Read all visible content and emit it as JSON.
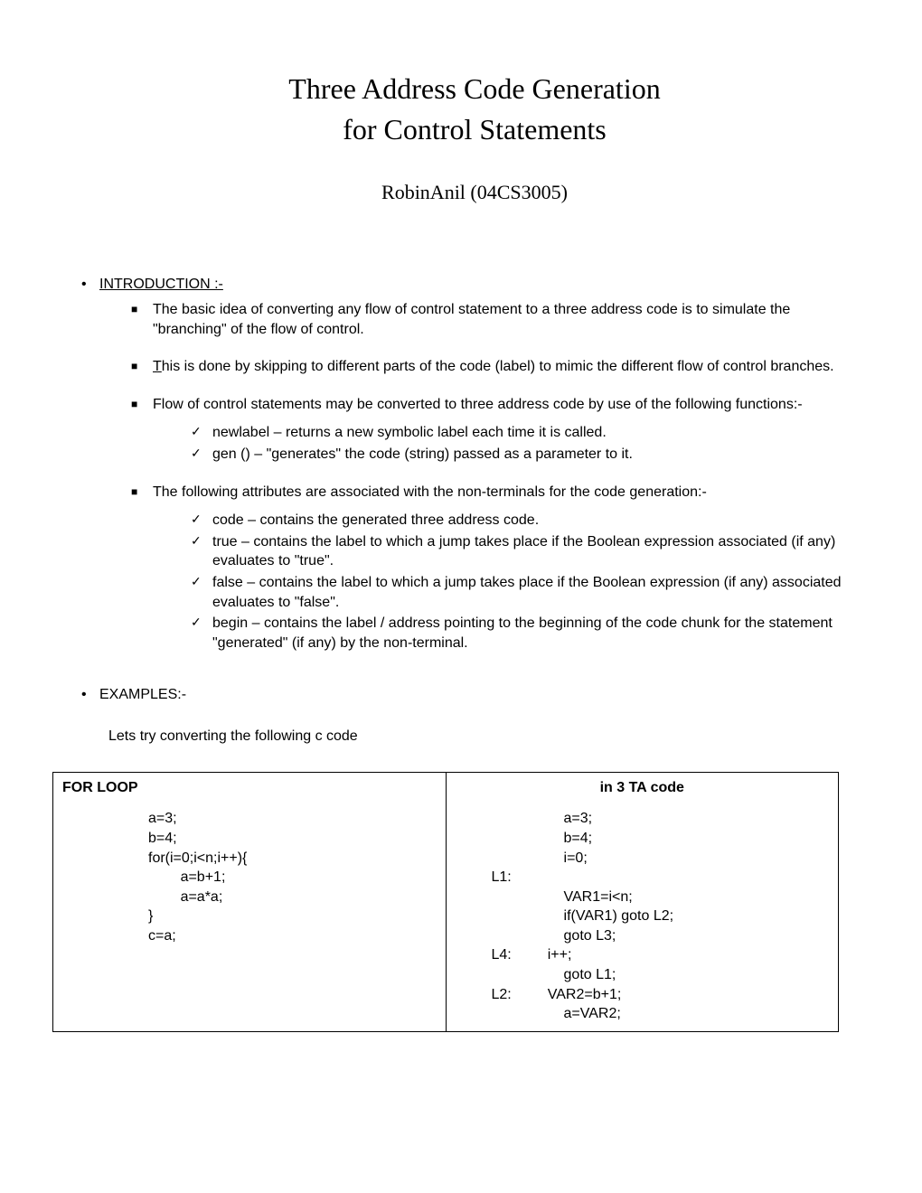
{
  "title": "Three Address Code Generation",
  "subtitle": "for Control Statements",
  "author": "RobinAnil (04CS3005)",
  "intro": {
    "heading": "INTRODUCTION :-",
    "items": [
      "The basic idea of converting any flow of control statement to a three address code is to simulate the \"branching\" of the flow of control.",
      "This is done by skipping to different parts of the code (label) to mimic the different flow of control branches.",
      "Flow of control statements may be converted to three address code by use of the following functions:-",
      "The following attributes are associated with the non-terminals for the code generation:-"
    ],
    "functions": [
      "newlabel – returns a new symbolic label each time it is called.",
      "gen () – \"generates\" the code (string) passed as a parameter to it."
    ],
    "attributes": [
      "code – contains the generated three address code.",
      "true – contains the label to which a jump takes place if the Boolean expression associated (if any) evaluates to \"true\".",
      "false – contains the label to which a jump takes place if the Boolean expression (if any) associated evaluates to \"false\".",
      "begin – contains the label / address pointing to the beginning of the code chunk for the statement \"generated\" (if any) by the non-terminal."
    ]
  },
  "examples": {
    "heading": "EXAMPLES:-",
    "intro": "Lets try converting the following c code",
    "table": {
      "left_header": "FOR LOOP",
      "right_header": "in 3 TA code",
      "left_code": "a=3;\nb=4;\nfor(i=0;i<n;i++){\n        a=b+1;\n        a=a*a;\n}\nc=a;",
      "right_code": "                  a=3;\n                  b=4;\n                  i=0;\nL1:\n                  VAR1=i<n;\n                  if(VAR1) goto L2;\n                  goto L3;\nL4:         i++;\n                  goto L1;\nL2:         VAR2=b+1;\n                  a=VAR2;"
    }
  }
}
